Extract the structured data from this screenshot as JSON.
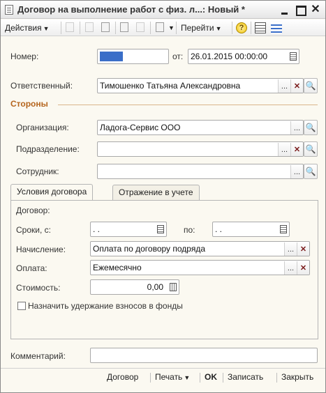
{
  "window": {
    "title": "Договор на выполнение работ с физ. л...: Новый *",
    "minimize": "_",
    "maximize": "□",
    "close": "✕"
  },
  "toolbar": {
    "actions_label": "Действия",
    "goto_label": "Перейти",
    "help_label": "?"
  },
  "form": {
    "number_label": "Номер:",
    "date_label": "от:",
    "date_value": "26.01.2015 00:00:00",
    "responsible_label": "Ответственный:",
    "responsible_value": "Тимошенко Татьяна Александровна",
    "parties_section": "Стороны",
    "organization_label": "Организация:",
    "organization_value": "Ладога-Сервис ООО",
    "subdivision_label": "Подразделение:",
    "subdivision_value": "",
    "employee_label": "Сотрудник:",
    "employee_value": "",
    "select_glyph": "...",
    "clear_glyph": "✕",
    "search_glyph": "🔍"
  },
  "tabs": [
    {
      "label": "Условия договора"
    },
    {
      "label": "Отражение в учете"
    }
  ],
  "conditions": {
    "contract_label": "Договор:",
    "terms_label": "Сроки, с:",
    "terms_from": ". .",
    "terms_to_label": "по:",
    "terms_to": ". .",
    "accrual_label": "Начисление:",
    "accrual_value": "Оплата по договору подряда",
    "payment_label": "Оплата:",
    "payment_value": "Ежемесячно",
    "cost_label": "Стоимость:",
    "cost_value": "0,00",
    "withholding_label": "Назначить удержание взносов в фонды"
  },
  "comment": {
    "label": "Комментарий:",
    "value": ""
  },
  "bottom": {
    "contract": "Договор",
    "print": "Печать",
    "ok": "OK",
    "save": "Записать",
    "close": "Закрыть"
  },
  "colors": {
    "section": "#b5651d",
    "number_block": "#3a6ec8"
  }
}
